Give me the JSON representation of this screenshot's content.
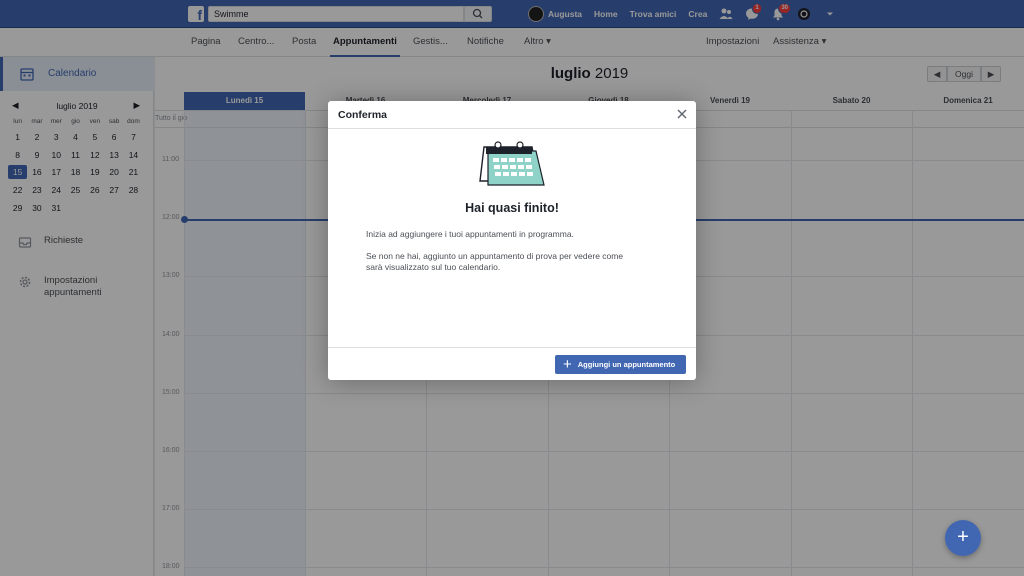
{
  "topbar": {
    "search_value": "Swimme",
    "user_name": "Augusta",
    "links": [
      "Home",
      "Trova amici",
      "Crea"
    ],
    "messages_badge": "1",
    "notifications_badge": "30"
  },
  "pagenav": {
    "tabs": [
      "Pagina",
      "Centro...",
      "Posta",
      "Appuntamenti",
      "Gestis...",
      "Notifiche",
      "Altro ▾"
    ],
    "right": [
      "Impostazioni",
      "Assistenza ▾"
    ]
  },
  "sidebar": {
    "calendar_label": "Calendario",
    "mini_month": "luglio 2019",
    "dow": [
      "lun",
      "mar",
      "mer",
      "gio",
      "ven",
      "sab",
      "dom"
    ],
    "weeks": [
      [
        "1",
        "2",
        "3",
        "4",
        "5",
        "6",
        "7"
      ],
      [
        "8",
        "9",
        "10",
        "11",
        "12",
        "13",
        "14"
      ],
      [
        "15",
        "16",
        "17",
        "18",
        "19",
        "20",
        "21"
      ],
      [
        "22",
        "23",
        "24",
        "25",
        "26",
        "27",
        "28"
      ],
      [
        "29",
        "30",
        "31",
        "",
        "",
        "",
        ""
      ]
    ],
    "selected_day": "15",
    "requests_label": "Richieste",
    "settings_label_1": "Impostazioni",
    "settings_label_2": "appuntamenti"
  },
  "calendar": {
    "month_bold": "luglio",
    "year": "2019",
    "today_btn": "Oggi",
    "days": [
      "Lunedì 15",
      "Martedì 16",
      "Mercoledì 17",
      "Giovedì 18",
      "Venerdì 19",
      "Sabato 20",
      "Domenica 21"
    ],
    "allday_label": "Tutto il gio",
    "hours": [
      "11:00",
      "12:00",
      "13:00",
      "14:00",
      "15:00",
      "16:00",
      "17:00",
      "18:00"
    ]
  },
  "dialog": {
    "title": "Conferma",
    "heading": "Hai quasi finito!",
    "para1": "Inizia ad aggiungere i tuoi appuntamenti in programma.",
    "para2_line1": "Se non ne hai, aggiunto un appuntamento di prova per vedere come",
    "para2_line2": "sarà visualizzato sul tuo calendario.",
    "button": "Aggiungi un appuntamento"
  },
  "fab": {
    "label": "+"
  },
  "colors": {
    "brand": "#4267b2",
    "badge": "#fa3e3e"
  }
}
